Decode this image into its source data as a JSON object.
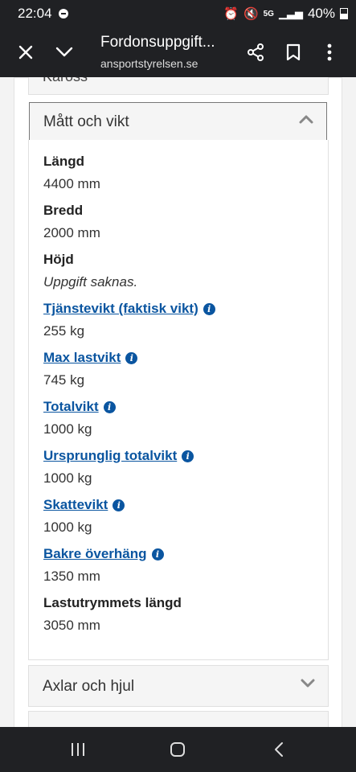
{
  "status": {
    "time": "22:04",
    "network": "5G",
    "battery": "40%"
  },
  "appbar": {
    "title": "Fordonsuppgift...",
    "url": "ansportstyrelsen.se"
  },
  "prev_panel": {
    "label": "Kaross"
  },
  "section": {
    "title": "Mått och vikt",
    "fields": [
      {
        "label": "Längd",
        "value": "4400 mm",
        "link": false,
        "info": false
      },
      {
        "label": "Bredd",
        "value": "2000 mm",
        "link": false,
        "info": false
      },
      {
        "label": "Höjd",
        "value": "Uppgift saknas.",
        "link": false,
        "info": false,
        "missing": true
      },
      {
        "label": "Tjänstevikt (faktisk vikt)",
        "value": "255 kg",
        "link": true,
        "info": true
      },
      {
        "label": "Max lastvikt",
        "value": "745 kg",
        "link": true,
        "info": true
      },
      {
        "label": "Totalvikt",
        "value": "1000 kg",
        "link": true,
        "info": true
      },
      {
        "label": "Ursprunglig totalvikt",
        "value": "1000 kg",
        "link": true,
        "info": true
      },
      {
        "label": "Skattevikt",
        "value": "1000 kg",
        "link": true,
        "info": true
      },
      {
        "label": "Bakre överhäng",
        "value": "1350 mm",
        "link": true,
        "info": true
      },
      {
        "label": "Lastutrymmets längd",
        "value": "3050 mm",
        "link": false,
        "info": false
      }
    ]
  },
  "next_panel": {
    "label": "Axlar och hjul"
  },
  "colors": {
    "link": "#0a55a0",
    "bar": "#202124"
  }
}
